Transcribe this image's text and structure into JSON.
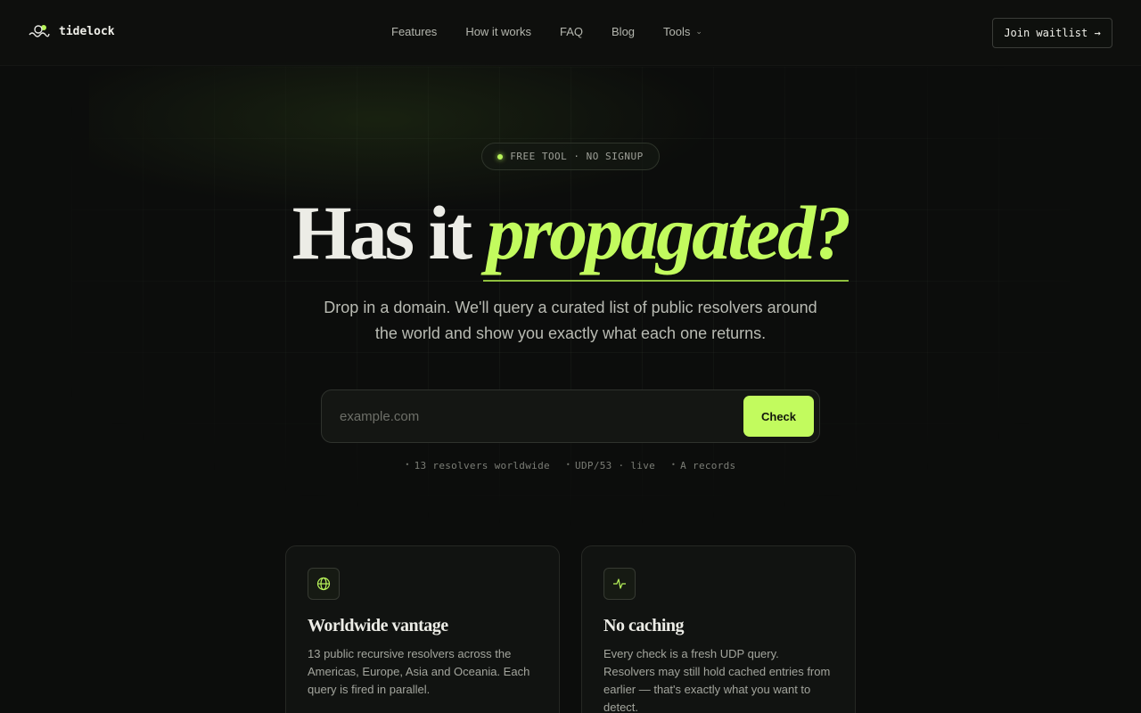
{
  "brand": {
    "name": "tidelock"
  },
  "nav": {
    "items": [
      "Features",
      "How it works",
      "FAQ",
      "Blog",
      "Tools"
    ],
    "tools_chevron": "⌄"
  },
  "header": {
    "cta_label": "Join waitlist →"
  },
  "hero": {
    "badge": "FREE TOOL · NO SIGNUP",
    "headline_plain": "Has it ",
    "headline_accent": "propagated?",
    "subcopy": "Drop in a domain. We'll query a curated list of public resolvers around the world and show you exactly what each one returns."
  },
  "search": {
    "placeholder": "example.com",
    "value": "",
    "button_label": "Check"
  },
  "meta": [
    "13 resolvers worldwide",
    "UDP/53 · live",
    "A records"
  ],
  "cards": [
    {
      "icon": "globe-icon",
      "title": "Worldwide vantage",
      "body": "13 public recursive resolvers across the Americas, Europe, Asia and Oceania. Each query is fired in parallel."
    },
    {
      "icon": "activity-icon",
      "title": "No caching",
      "body": "Every check is a fresh UDP query. Resolvers may still hold cached entries from earlier — that's exactly what you want to detect."
    }
  ],
  "colors": {
    "accent": "#c2fb5e",
    "background": "#0c0d0c",
    "border": "#2f322d"
  }
}
